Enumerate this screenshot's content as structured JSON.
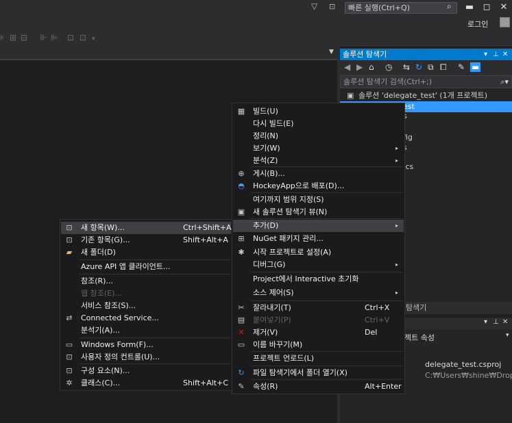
{
  "titlebar": {
    "quick_launch_placeholder": "빠른 실행(Ctrl+Q)",
    "login_label": "로그인",
    "minimize_glyph": "▬",
    "maximize_glyph": "◻",
    "close_glyph": "✕"
  },
  "solution_explorer": {
    "title": "솔루션 탐색기",
    "search_placeholder": "솔루션 탐색기 검색(Ctrl+;)",
    "tree": [
      {
        "label": "솔루션 'delegate_test' (1개 프로젝트)",
        "selected": false
      },
      {
        "label": "est",
        "selected": true
      },
      {
        "label": "s",
        "selected": false
      },
      {
        "label": "fig",
        "selected": false
      },
      {
        "label": "s",
        "selected": false
      },
      {
        "label": ".cs",
        "selected": false
      }
    ],
    "bottom_tab": "탐색기"
  },
  "properties": {
    "section_label": "젝트 속성",
    "file_name_value": "delegate_test.csproj",
    "file_path_value": "C:₩Users₩shine₩Dropbox₩"
  },
  "main_menu": {
    "items": [
      {
        "label": "빌드(U)",
        "shortcut": "",
        "icon": "build-icon",
        "glyph": "▦",
        "submenu": false
      },
      {
        "label": "다시 빌드(E)",
        "shortcut": "",
        "icon": "",
        "glyph": "",
        "submenu": false
      },
      {
        "label": "정리(N)",
        "shortcut": "",
        "icon": "",
        "glyph": "",
        "submenu": false
      },
      {
        "label": "보기(W)",
        "shortcut": "",
        "icon": "",
        "glyph": "",
        "submenu": true
      },
      {
        "label": "분석(Z)",
        "shortcut": "",
        "icon": "",
        "glyph": "",
        "submenu": true
      },
      {
        "label": "게시(B)...",
        "shortcut": "",
        "icon": "globe-icon",
        "glyph": "⊕",
        "submenu": false
      },
      {
        "label": "HockeyApp으로 배포(D)...",
        "shortcut": "",
        "icon": "hockeyapp-icon",
        "glyph": "◓",
        "submenu": false
      },
      {
        "label": "여기까지 범위 지정(S)",
        "shortcut": "",
        "icon": "",
        "glyph": "",
        "submenu": false
      },
      {
        "label": "새 솔루션 탐색기 뷰(N)",
        "shortcut": "",
        "icon": "new-view-icon",
        "glyph": "▣",
        "submenu": false
      },
      {
        "label": "추가(D)",
        "shortcut": "",
        "icon": "",
        "glyph": "",
        "submenu": true,
        "highlight": true
      },
      {
        "label": "NuGet 패키지 관리...",
        "shortcut": "",
        "icon": "nuget-icon",
        "glyph": "⊞",
        "submenu": false
      },
      {
        "label": "시작 프로젝트로 설정(A)",
        "shortcut": "",
        "icon": "gear-icon",
        "glyph": "✱",
        "submenu": false
      },
      {
        "label": "디버그(G)",
        "shortcut": "",
        "icon": "",
        "glyph": "",
        "submenu": true
      },
      {
        "label": "Project에서 Interactive 초기화",
        "shortcut": "",
        "icon": "",
        "glyph": "",
        "submenu": false
      },
      {
        "label": "소스 제어(S)",
        "shortcut": "",
        "icon": "",
        "glyph": "",
        "submenu": true
      },
      {
        "label": "잘라내기(T)",
        "shortcut": "Ctrl+X",
        "icon": "scissors-icon",
        "glyph": "✂",
        "submenu": false
      },
      {
        "label": "붙여넣기(P)",
        "shortcut": "Ctrl+V",
        "icon": "paste-icon",
        "glyph": "▤",
        "submenu": false,
        "disabled": true
      },
      {
        "label": "제거(V)",
        "shortcut": "Del",
        "icon": "delete-icon",
        "glyph": "✕",
        "submenu": false
      },
      {
        "label": "이름 바꾸기(M)",
        "shortcut": "",
        "icon": "rename-icon",
        "glyph": "▭",
        "submenu": false
      },
      {
        "label": "프로젝트 언로드(L)",
        "shortcut": "",
        "icon": "",
        "glyph": "",
        "submenu": false
      },
      {
        "label": "파일 탐색기에서 폴더 열기(X)",
        "shortcut": "",
        "icon": "refresh-arrow-icon",
        "glyph": "↻",
        "submenu": false
      },
      {
        "label": "속성(R)",
        "shortcut": "Alt+Enter",
        "icon": "wrench-icon",
        "glyph": "✎",
        "submenu": false
      }
    ]
  },
  "add_submenu": {
    "items": [
      {
        "label": "새 항목(W)...",
        "shortcut": "Ctrl+Shift+A",
        "icon": "new-item-icon",
        "glyph": "⊡",
        "highlight": true
      },
      {
        "label": "기존 항목(G)...",
        "shortcut": "Shift+Alt+A",
        "icon": "existing-item-icon",
        "glyph": "⊡"
      },
      {
        "label": "새 폴더(D)",
        "shortcut": "",
        "icon": "folder-icon",
        "glyph": "▰"
      },
      {
        "label": "Azure API 앱 클라이언트...",
        "shortcut": "",
        "icon": "",
        "glyph": ""
      },
      {
        "label": "참조(R)...",
        "shortcut": "",
        "icon": "",
        "glyph": ""
      },
      {
        "label": "웹 참조(E)...",
        "shortcut": "",
        "icon": "",
        "glyph": "",
        "disabled": true
      },
      {
        "label": "서비스 참조(S)...",
        "shortcut": "",
        "icon": "",
        "glyph": ""
      },
      {
        "label": "Connected Service...",
        "shortcut": "",
        "icon": "connected-service-icon",
        "glyph": "⇄"
      },
      {
        "label": "분석기(A)...",
        "shortcut": "",
        "icon": "",
        "glyph": ""
      },
      {
        "label": "Windows Form(F)...",
        "shortcut": "",
        "icon": "windows-form-icon",
        "glyph": "▭"
      },
      {
        "label": "사용자 정의 컨트롤(U)...",
        "shortcut": "",
        "icon": "user-control-icon",
        "glyph": "⊡"
      },
      {
        "label": "구성 요소(N)...",
        "shortcut": "",
        "icon": "component-icon",
        "glyph": "⊡"
      },
      {
        "label": "클래스(C)...",
        "shortcut": "Shift+Alt+C",
        "icon": "class-icon",
        "glyph": "✲"
      }
    ]
  }
}
